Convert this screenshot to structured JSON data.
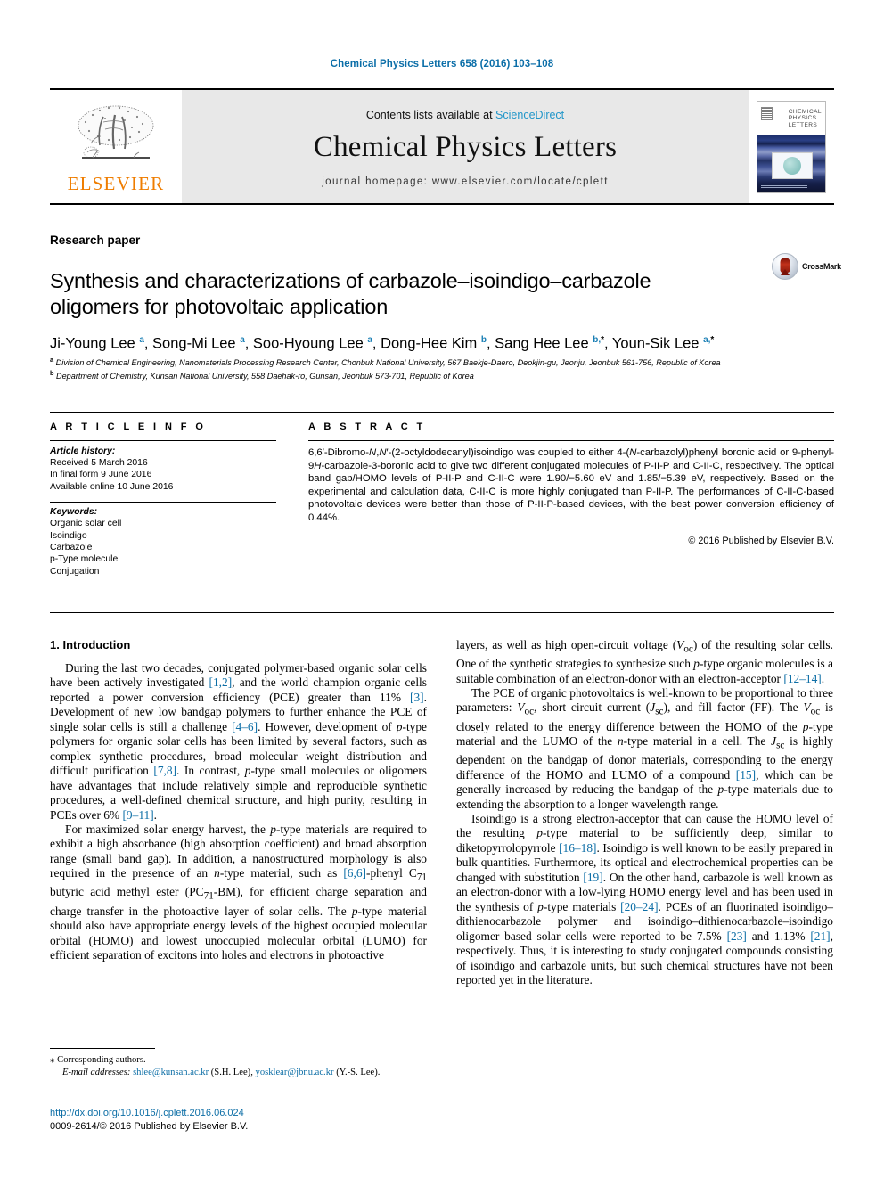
{
  "running_head": "Chemical Physics Letters 658 (2016) 103–108",
  "masthead": {
    "publisher": "ELSEVIER",
    "contents_prefix": "Contents lists available at ",
    "contents_link": "ScienceDirect",
    "journal_title": "Chemical Physics Letters",
    "homepage": "journal homepage: www.elsevier.com/locate/cplett",
    "cover_title": "CHEMICAL PHYSICS LETTERS"
  },
  "article": {
    "type": "Research paper",
    "title": "Synthesis and characterizations of carbazole–isoindigo–carbazole oligomers for photovoltaic application",
    "crossmark_label": "CrossMark",
    "authors_html": "Ji-Young Lee <sup>a</sup>, Song-Mi Lee <sup>a</sup>, Soo-Hyoung Lee <sup>a</sup>, Dong-Hee Kim <sup>b</sup>, Sang Hee Lee <sup>b,</sup><sup class=\"star\">*</sup>, Youn-Sik Lee <sup>a,</sup><sup class=\"star\">*</sup>",
    "affiliation_a": "Division of Chemical Engineering, Nanomaterials Processing Research Center, Chonbuk National University, 567 Baekje-Daero, Deokjin-gu, Jeonju, Jeonbuk 561-756, Republic of Korea",
    "affiliation_b": "Department of Chemistry, Kunsan National University, 558 Daehak-ro, Gunsan, Jeonbuk 573-701, Republic of Korea"
  },
  "article_info": {
    "heading": "A R T I C L E   I N F O",
    "history_label": "Article history:",
    "history": [
      "Received 5 March 2016",
      "In final form 9 June 2016",
      "Available online 10 June 2016"
    ],
    "keywords_label": "Keywords:",
    "keywords": [
      "Organic solar cell",
      "Isoindigo",
      "Carbazole",
      "p-Type molecule",
      "Conjugation"
    ]
  },
  "abstract": {
    "heading": "A B S T R A C T",
    "text": "6,6′-Dibromo-N,N′-(2-octyldodecanyl)isoindigo was coupled to either 4-(N-carbazolyl)phenyl boronic acid or 9-phenyl-9H-carbazole-3-boronic acid to give two different conjugated molecules of P-II-P and C-II-C, respectively. The optical band gap/HOMO levels of P-II-P and C-II-C were 1.90/−5.60 eV and 1.85/−5.39 eV, respectively. Based on the experimental and calculation data, C-II-C is more highly conjugated than P-II-P. The performances of C-II-C-based photovoltaic devices were better than those of P-II-P-based devices, with the best power conversion efficiency of 0.44%.",
    "copyright": "© 2016 Published by Elsevier B.V."
  },
  "sections": {
    "intro_heading": "1. Introduction",
    "left_paragraphs": [
      "During the last two decades, conjugated polymer-based organic solar cells have been actively investigated [1,2], and the world champion organic cells reported a power conversion efficiency (PCE) greater than 11% [3]. Development of new low bandgap polymers to further enhance the PCE of single solar cells is still a challenge [4–6]. However, development of p-type polymers for organic solar cells has been limited by several factors, such as complex synthetic procedures, broad molecular weight distribution and difficult purification [7,8]. In contrast, p-type small molecules or oligomers have advantages that include relatively simple and reproducible synthetic procedures, a well-defined chemical structure, and high purity, resulting in PCEs over 6% [9–11].",
      "For maximized solar energy harvest, the p-type materials are required to exhibit a high absorbance (high absorption coefficient) and broad absorption range (small band gap). In addition, a nanostructured morphology is also required in the presence of an n-type material, such as [6,6]-phenyl C71 butyric acid methyl ester (PC71-BM), for efficient charge separation and charge transfer in the photoactive layer of solar cells. The p-type material should also have appropriate energy levels of the highest occupied molecular orbital (HOMO) and lowest unoccupied molecular orbital (LUMO) for efficient separation of excitons into holes and electrons in photoactive"
    ],
    "right_paragraphs": [
      "layers, as well as high open-circuit voltage (Voc) of the resulting solar cells. One of the synthetic strategies to synthesize such p-type organic molecules is a suitable combination of an electron-donor with an electron-acceptor [12–14].",
      "The PCE of organic photovoltaics is well-known to be proportional to three parameters: Voc, short circuit current (Jsc), and fill factor (FF). The Voc is closely related to the energy difference between the HOMO of the p-type material and the LUMO of the n-type material in a cell. The Jsc is highly dependent on the bandgap of donor materials, corresponding to the energy difference of the HOMO and LUMO of a compound [15], which can be generally increased by reducing the bandgap of the p-type materials due to extending the absorption to a longer wavelength range.",
      "Isoindigo is a strong electron-acceptor that can cause the HOMO level of the resulting p-type material to be sufficiently deep, similar to diketopyrrolopyrrole [16–18]. Isoindigo is well known to be easily prepared in bulk quantities. Furthermore, its optical and electrochemical properties can be changed with substitution [19]. On the other hand, carbazole is well known as an electron-donor with a low-lying HOMO energy level and has been used in the synthesis of p-type materials [20–24]. PCEs of an fluorinated isoindigo–dithienocarbazole polymer and isoindigo–dithienocarbazole–isoindigo oligomer based solar cells were reported to be 7.5% [23] and 1.13% [21], respectively. Thus, it is interesting to study conjugated compounds consisting of isoindigo and carbazole units, but such chemical structures have not been reported yet in the literature."
    ]
  },
  "footnote": {
    "corresponding": "Corresponding authors.",
    "email_label": "E-mail addresses:",
    "email1": "shlee@kunsan.ac.kr",
    "email1_who": "(S.H. Lee),",
    "email2": "yosklear@jbnu.ac.kr",
    "email2_who": "(Y.-S. Lee)."
  },
  "doi": {
    "url": "http://dx.doi.org/10.1016/j.cplett.2016.06.024",
    "issn": "0009-2614/© 2016 Published by Elsevier B.V."
  },
  "colors": {
    "link": "#0d6ea6",
    "elsevier_orange": "#ef7d00",
    "sciencedirect": "#2196c9"
  }
}
